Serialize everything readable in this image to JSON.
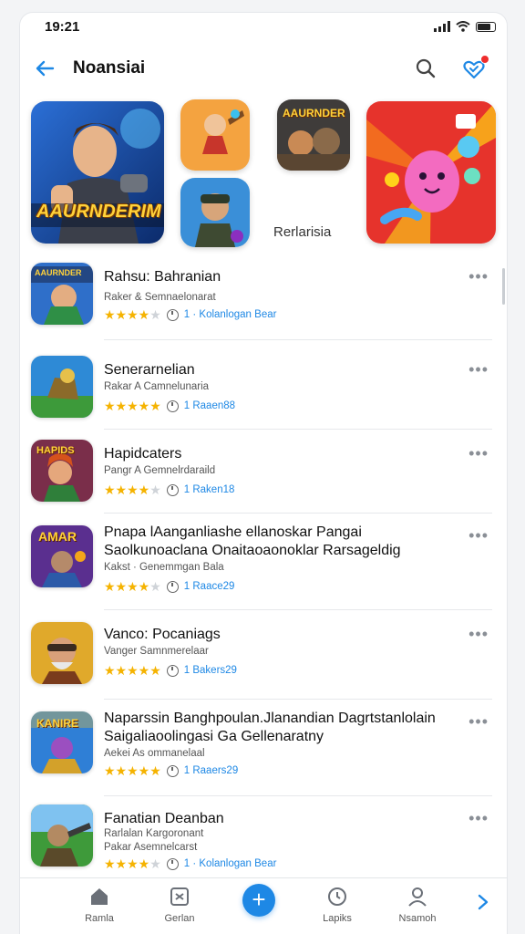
{
  "status": {
    "time": "19:21"
  },
  "header": {
    "title": "Noansiai"
  },
  "featured": {
    "caption": "Rerlarisia",
    "big_art_text": "AAURNDERIM",
    "small_art_text": "AAURNDER"
  },
  "apps": [
    {
      "name": "Rahsu: Bahranian",
      "sub": "Raker & Semnaelonarat",
      "rating": 3.5,
      "meta": "1 · Kolanlogan Bear",
      "thumb_text": "AAURNDER"
    },
    {
      "name": "Senerarnelian",
      "sub": "Rakar A Camnelunaria",
      "rating": 5,
      "meta": "1 Raaen88",
      "thumb_text": ""
    },
    {
      "name": "Hapidcaters",
      "sub": "Pangr A Gemnelrdaraild",
      "rating": 4,
      "meta": "1 Raken18",
      "thumb_text": "HAPIDS"
    },
    {
      "name": "Pnapa lAanganliashe ellanoskar Pangai Saolkunoaclana Onaitaoaonoklar Rarsageldig",
      "sub": "Kakst · Genemmgan Bala",
      "rating": 3.5,
      "meta": "1 Raace29",
      "thumb_text": "AMAR"
    },
    {
      "name": "Vanco: Pocaniags",
      "sub": "Vanger Samnmerelaar",
      "rating": 5,
      "meta": "1 Bakers29",
      "thumb_text": ""
    },
    {
      "name": "Naparssin Banghpoulan.Jlanandian Dagrtstanlolain Saigaliaoolingasi Ga Gellenaratny",
      "sub": "Aekei As ommanelaal",
      "rating": 5,
      "meta": "1 Raaers29",
      "thumb_text": "KANIRE"
    },
    {
      "name": "Fanatian Deanban",
      "sub": "Rarlalan Kargoronant",
      "sub2": "Pakar Asemnelcarst",
      "rating": 4,
      "meta": "1 · Kolanlogan Bear",
      "thumb_text": ""
    }
  ],
  "tabs": [
    {
      "label": "Ramla",
      "icon": "home-icon"
    },
    {
      "label": "Gerlan",
      "icon": "games-icon"
    },
    {
      "label": "Lapiks",
      "icon": "clock-icon"
    },
    {
      "label": "Nsamoh",
      "icon": "profile-icon"
    }
  ],
  "colors": {
    "accent": "#1e88e5",
    "star": "#f5b301",
    "badge": "#ef2d2d"
  }
}
